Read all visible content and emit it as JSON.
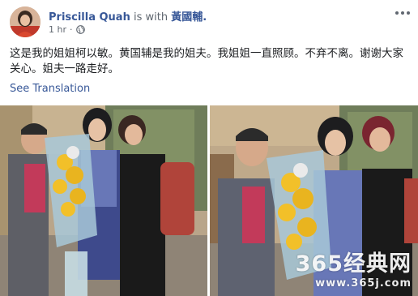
{
  "post": {
    "author": "Priscilla Quah",
    "with_text": "is with",
    "tagged": "黃國輔.",
    "time": "1 hr",
    "text": "这是我的姐姐柯以敏。黄国辅是我的姐夫。我姐姐一直照顾。不弃不离。谢谢大家关心。姐夫一路走好。",
    "see_translation": "See Translation"
  },
  "watermark": {
    "brand": "365经典网",
    "url": "www.365j.com"
  },
  "icons": {
    "more": "more-options-icon",
    "privacy": "globe-icon"
  }
}
